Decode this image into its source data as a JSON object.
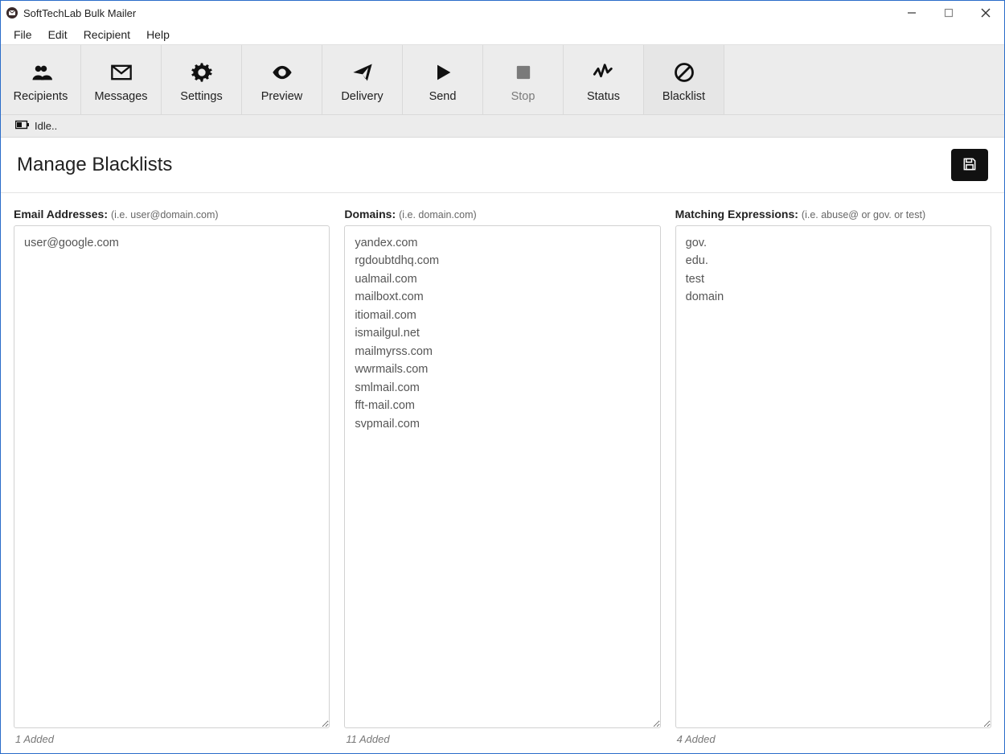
{
  "window": {
    "title": "SoftTechLab Bulk Mailer"
  },
  "menubar": {
    "items": [
      "File",
      "Edit",
      "Recipient",
      "Help"
    ]
  },
  "toolbar": {
    "items": [
      {
        "key": "recipients",
        "label": "Recipients",
        "icon": "users-icon"
      },
      {
        "key": "messages",
        "label": "Messages",
        "icon": "envelope-icon"
      },
      {
        "key": "settings",
        "label": "Settings",
        "icon": "gear-icon"
      },
      {
        "key": "preview",
        "label": "Preview",
        "icon": "eye-icon"
      },
      {
        "key": "delivery",
        "label": "Delivery",
        "icon": "paper-plane-icon"
      },
      {
        "key": "send",
        "label": "Send",
        "icon": "play-icon"
      },
      {
        "key": "stop",
        "label": "Stop",
        "icon": "stop-icon",
        "disabled": true
      },
      {
        "key": "status",
        "label": "Status",
        "icon": "activity-icon"
      },
      {
        "key": "blacklist",
        "label": "Blacklist",
        "icon": "ban-icon",
        "active": true
      }
    ]
  },
  "status_strip": {
    "text": "Idle.."
  },
  "page": {
    "title": "Manage Blacklists"
  },
  "columns": {
    "emails": {
      "label": "Email Addresses",
      "hint": "(i.e. user@domain.com)",
      "items": [
        "user@google.com"
      ],
      "count_label": "1 Added"
    },
    "domains": {
      "label": "Domains",
      "hint": "(i.e. domain.com)",
      "items": [
        "yandex.com",
        "rgdoubtdhq.com",
        "ualmail.com",
        "mailboxt.com",
        "itiomail.com",
        "ismailgul.net",
        "mailmyrss.com",
        "wwrmails.com",
        "smlmail.com",
        "fft-mail.com",
        "svpmail.com"
      ],
      "count_label": "11 Added"
    },
    "expressions": {
      "label": "Matching Expressions",
      "hint": "(i.e. abuse@ or gov. or test)",
      "items": [
        "gov.",
        "edu.",
        "test",
        "domain"
      ],
      "count_label": "4 Added"
    }
  }
}
